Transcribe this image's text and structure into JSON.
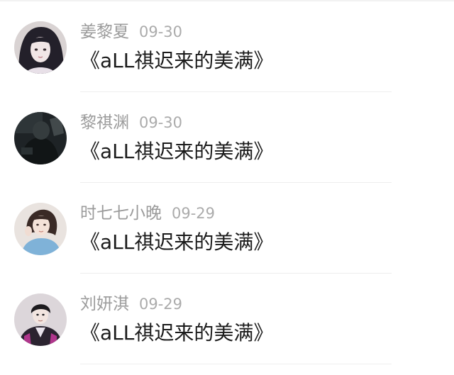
{
  "comments": [
    {
      "name": "姜黎夏",
      "time": "09-30",
      "text": "《aLL祺迟来的美满》",
      "avatar": "avatar-girl-dark-hair"
    },
    {
      "name": "黎祺渊",
      "time": "09-30",
      "text": "《aLL祺迟来的美满》",
      "avatar": "avatar-dark-photo"
    },
    {
      "name": "时七七小晚",
      "time": "09-29",
      "text": "《aLL祺迟来的美满》",
      "avatar": "avatar-girl-blue-shirt"
    },
    {
      "name": "刘妍淇",
      "time": "09-29",
      "text": "《aLL祺迟来的美满》",
      "avatar": "avatar-boy-jacket"
    }
  ]
}
